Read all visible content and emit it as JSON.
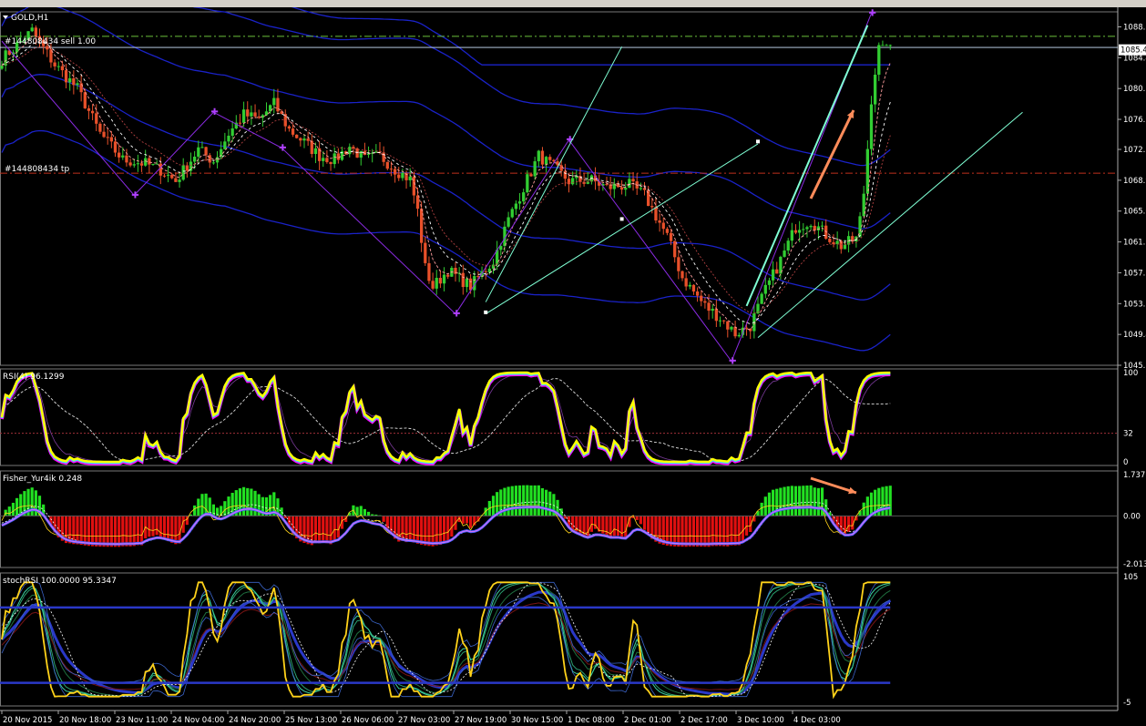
{
  "window": {
    "symbol_label": "GOLD,H1"
  },
  "order_labels": {
    "sell": "#144808434 sell 1.00",
    "tp": "#144808434 tp"
  },
  "price_axis": {
    "ticks": [
      "1088.3",
      "1084.4",
      "1080.5",
      "1076.6",
      "1072.8",
      "1068.9",
      "1065.0",
      "1061.1",
      "1057.2",
      "1053.3",
      "1049.4",
      "1045.5"
    ],
    "current_price": "1085.4"
  },
  "time_axis": {
    "ticks": [
      "20 Nov 2015",
      "20 Nov 18:00",
      "23 Nov 11:00",
      "24 Nov 04:00",
      "24 Nov 20:00",
      "25 Nov 13:00",
      "26 Nov 06:00",
      "27 Nov 03:00",
      "27 Nov 19:00",
      "30 Nov 15:00",
      "1 Dec 08:00",
      "2 Dec 01:00",
      "2 Dec 17:00",
      "3 Dec 10:00",
      "4 Dec 03:00"
    ]
  },
  "panels": {
    "rsi": {
      "label": "RSI(4) 96.1299",
      "ticks": [
        "100",
        "32",
        "0"
      ]
    },
    "fisher": {
      "label": "Fisher_Yur4ik 0.248",
      "ticks": [
        "1.737",
        "0.00",
        "-2.013"
      ]
    },
    "stoch": {
      "label": "stochRSI 100.0000 95.3347",
      "ticks": [
        "105",
        "-5"
      ]
    }
  },
  "colors": {
    "bull": "#32cd32",
    "bear": "#e8502a",
    "band": "#1a22c8",
    "cyan": "#7fffd4",
    "rsi_main": "#ffff00",
    "rsi_pink": "#ff00ff",
    "hist_pos": "#22e022",
    "hist_neg": "#e01010",
    "stoch_main": "#ffd21a",
    "arrow": "#ff8c5a"
  },
  "chart_data": [
    {
      "type": "candlestick",
      "title": "GOLD,H1",
      "ylim": [
        1045.5,
        1090.2
      ],
      "close_path": [
        [
          0,
          1084.2
        ],
        [
          8,
          1087.8
        ],
        [
          14,
          1083.5
        ],
        [
          20,
          1080.5
        ],
        [
          26,
          1074.8
        ],
        [
          32,
          1071.5
        ],
        [
          38,
          1071.0
        ],
        [
          42,
          1070.2
        ],
        [
          46,
          1068.8
        ],
        [
          52,
          1072.8
        ],
        [
          56,
          1071.3
        ],
        [
          60,
          1074.8
        ],
        [
          64,
          1077.2
        ],
        [
          68,
          1076.6
        ],
        [
          72,
          1078.6
        ],
        [
          76,
          1075.3
        ],
        [
          80,
          1073.7
        ],
        [
          84,
          1072.0
        ],
        [
          88,
          1071.5
        ],
        [
          92,
          1073.2
        ],
        [
          96,
          1071.5
        ],
        [
          100,
          1072.0
        ],
        [
          104,
          1070.3
        ],
        [
          108,
          1069.0
        ],
        [
          110,
          1065.0
        ],
        [
          112,
          1057.8
        ],
        [
          114,
          1055.4
        ],
        [
          118,
          1057.5
        ],
        [
          124,
          1055.5
        ],
        [
          130,
          1058.7
        ],
        [
          134,
          1063.9
        ],
        [
          138,
          1068.0
        ],
        [
          142,
          1072.0
        ],
        [
          146,
          1070.5
        ],
        [
          150,
          1068.8
        ],
        [
          156,
          1068.9
        ],
        [
          160,
          1068.0
        ],
        [
          166,
          1068.3
        ],
        [
          170,
          1067.0
        ],
        [
          176,
          1061.8
        ],
        [
          180,
          1056.6
        ],
        [
          186,
          1053.0
        ],
        [
          190,
          1051.5
        ],
        [
          194,
          1049.5
        ],
        [
          198,
          1050.5
        ],
        [
          202,
          1055.0
        ],
        [
          206,
          1058.8
        ],
        [
          210,
          1063.0
        ],
        [
          214,
          1063.8
        ],
        [
          218,
          1062.0
        ],
        [
          222,
          1060.6
        ],
        [
          226,
          1061.5
        ],
        [
          228,
          1067.2
        ],
        [
          230,
          1078.5
        ],
        [
          232,
          1086.0
        ]
      ],
      "series": [
        {
          "name": "#144808434 sell 1.00",
          "level": 1087.1
        },
        {
          "name": "#144808434 tp",
          "level": 1069.8
        }
      ]
    },
    {
      "type": "line",
      "title": "RSI(4) 96.1299",
      "ylim": [
        0,
        100
      ],
      "series": [
        {
          "name": "RSI(4)",
          "value": 96.1299
        }
      ],
      "levels": [
        32
      ]
    },
    {
      "type": "bar",
      "title": "Fisher_Yur4ik 0.248",
      "ylim": [
        -2.013,
        1.737
      ],
      "series": [
        {
          "name": "Fisher_Yur4ik",
          "value": 0.248
        }
      ]
    },
    {
      "type": "line",
      "title": "stochRSI 100.0000 95.3347",
      "ylim": [
        -5,
        105
      ],
      "series": [
        {
          "name": "stochRSI",
          "values": [
            100.0,
            95.3347
          ]
        }
      ]
    }
  ]
}
